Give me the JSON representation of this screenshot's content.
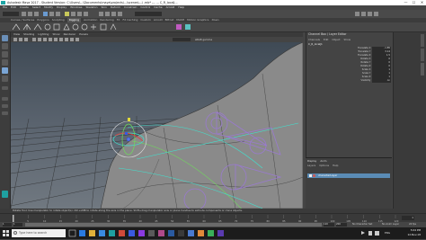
{
  "window": {
    "title": "Autodesk Maya 2017 - Student Version: C:\\Users\\...\\Documents\\maya\\projects\\...\\scenes\\...\\ .mb* --- ... C_R_localJ...",
    "controls": [
      "—",
      "☐",
      "✕"
    ]
  },
  "menubar": [
    "File",
    "Edit",
    "Create",
    "Select",
    "Modify",
    "Display",
    "Windows",
    "Skeleton",
    "Skin",
    "Deform",
    "Constrain",
    "Control",
    "Cache",
    "Arnold",
    "Help"
  ],
  "shelf_tabs": [
    "Curves / Surfaces",
    "Polygons",
    "Sculpting",
    "Rigging",
    "Animation",
    "Rendering",
    "FX",
    "FX Caching",
    "Custom",
    "Arnold",
    "Bifrost",
    "MASH",
    "Motion Graphics",
    "XGen"
  ],
  "shelf_active": "Rigging",
  "viewport_menu": [
    "View",
    "Shading",
    "Lighting",
    "Show",
    "Renderer",
    "Panels"
  ],
  "viewport_colorspace": "sRGB gamma",
  "channel_box": {
    "tabs": "Channel Box / Layer Editor",
    "menu": [
      "Channels",
      "Edit",
      "Object",
      "Show"
    ],
    "object": "C_R_localJ1",
    "channels": [
      {
        "name": "Translate X",
        "value": "-1.85"
      },
      {
        "name": "Translate Y",
        "value": "3.14"
      },
      {
        "name": "Translate Z",
        "value": "1.5"
      },
      {
        "name": "Rotate X",
        "value": "0"
      },
      {
        "name": "Rotate Y",
        "value": "0"
      },
      {
        "name": "Rotate Z",
        "value": "0"
      },
      {
        "name": "Scale X",
        "value": "1"
      },
      {
        "name": "Scale Y",
        "value": "1"
      },
      {
        "name": "Scale Z",
        "value": "1"
      },
      {
        "name": "Visibility",
        "value": "on"
      }
    ]
  },
  "layer_editor": {
    "tabs": [
      "Display",
      "Anim"
    ],
    "menu": [
      "Layers",
      "Options",
      "Help"
    ],
    "layer_name": "characterLayer"
  },
  "help_line": "Rotate Tool: Use manipulator to rotate object(s). Ctrl+LMB to rotate along the axis in the plane. Shift+drag manipulator axis or plane handles to extrude components or clone objects.",
  "time": {
    "current_frame": "1",
    "start": "1",
    "end": "120",
    "anim_end": "200",
    "ticks": [
      "5",
      "10",
      "15",
      "20",
      "25",
      "30",
      "35",
      "40",
      "45",
      "50",
      "55",
      "60",
      "65",
      "70",
      "75",
      "80",
      "85",
      "90",
      "95",
      "100",
      "105",
      "110",
      "115",
      "120"
    ],
    "character_set": "No Character Set",
    "anim_layer": "No Anim Layer",
    "fps": "24 fps"
  },
  "taskbar": {
    "search_placeholder": "Type here to search",
    "time": "5:04 PM",
    "date": "12-Nov-18",
    "lang": "ENG"
  },
  "colors": {
    "accent_blue": "#5a8bb5",
    "joint_purple": "#9a7ad0",
    "curve_cyan": "#3fe3d0",
    "curve_green": "#6ee05a"
  }
}
